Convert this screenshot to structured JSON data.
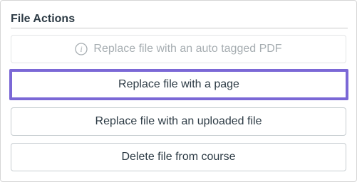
{
  "panel": {
    "title": "File Actions"
  },
  "actions": [
    {
      "label": "Replace file with an auto tagged PDF",
      "disabled": true,
      "icon": "info-icon"
    },
    {
      "label": "Replace file with a page",
      "disabled": false,
      "focused": true
    },
    {
      "label": "Replace file with an uploaded file",
      "disabled": false
    },
    {
      "label": "Delete file from course",
      "disabled": false
    }
  ],
  "colors": {
    "focus_ring": "#7b68d6",
    "text": "#2d3b45",
    "disabled_text": "#a6adb1"
  }
}
